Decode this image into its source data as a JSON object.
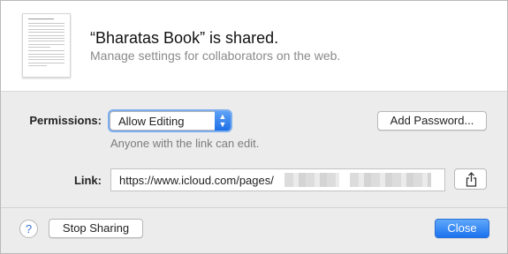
{
  "header": {
    "title": "“Bharatas Book” is shared.",
    "subtitle": "Manage settings for collaborators on the web."
  },
  "permissions": {
    "label": "Permissions:",
    "selected": "Allow Editing",
    "hint": "Anyone with the link can edit."
  },
  "add_password": {
    "label": "Add Password..."
  },
  "link": {
    "label": "Link:",
    "value": "https://www.icloud.com/pages/"
  },
  "footer": {
    "help_label": "?",
    "stop_sharing_label": "Stop Sharing",
    "close_label": "Close"
  },
  "colors": {
    "accent": "#1b72ee",
    "focus_ring": "#7aaef0"
  },
  "icons": {
    "document": "document-thumbnail-icon",
    "share": "share-icon",
    "popup_arrows": "up-down-chevron-icon"
  }
}
